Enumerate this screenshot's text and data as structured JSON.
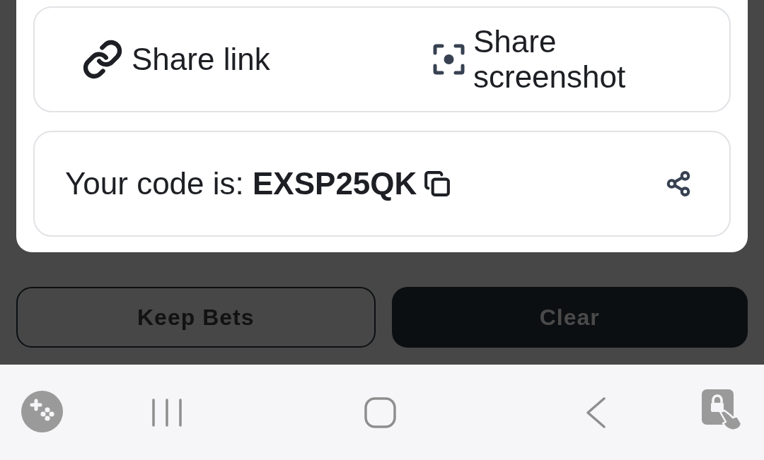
{
  "share_options": [
    {
      "kind": "link",
      "label": "Share link"
    },
    {
      "kind": "screenshot",
      "label": "Share screenshot"
    }
  ],
  "code": {
    "text": "Your code is: **EXSP25QK**"
  },
  "buttons": [
    {
      "kind": "outline",
      "label": "Keep Bets"
    },
    {
      "kind": "filled",
      "label": "Clear"
    }
  ]
}
